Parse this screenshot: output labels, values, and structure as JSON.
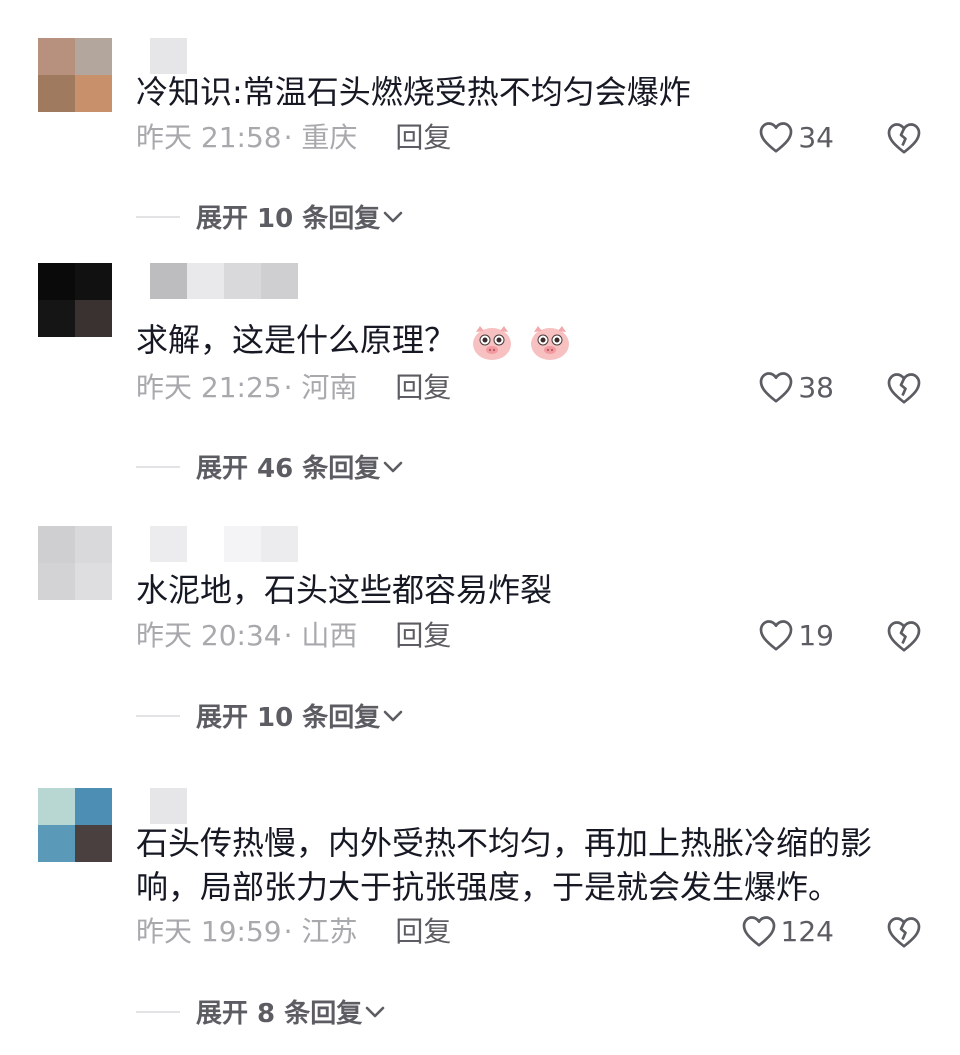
{
  "comments": [
    {
      "avatar_colors": [
        "#b8907e",
        "#b3a69c",
        "#a07a5e",
        "#c8916c"
      ],
      "name_colors": [
        "#e6e6e8"
      ],
      "text": "冷知识:常温石头燃烧受热不均匀会爆炸",
      "time": "昨天 21:58",
      "location": "· 重庆",
      "reply_label": "回复",
      "likes": "34",
      "expand_label": "展开 10 条回复"
    },
    {
      "avatar_colors": [
        "#0a0a0a",
        "#111111",
        "#151515",
        "#3a3230"
      ],
      "name_colors": [
        "#bdbdbf",
        "#e9e9eb",
        "#d9d9db",
        "#cfcfd1"
      ],
      "text": "求解，这是什么原理？",
      "emojis": [
        "pig-face-emoji",
        "pig-face-emoji"
      ],
      "time": "昨天 21:25",
      "location": "· 河南",
      "reply_label": "回复",
      "likes": "38",
      "expand_label": "展开 46 条回复"
    },
    {
      "avatar_colors": [
        "#cfcfd1",
        "#d9d9db",
        "#d3d3d5",
        "#dedee0"
      ],
      "name_colors": [
        "#ececee",
        "#ffffff",
        "#f4f4f6",
        "#ececee"
      ],
      "text": "水泥地，石头这些都容易炸裂",
      "time": "昨天 20:34",
      "location": "· 山西",
      "reply_label": "回复",
      "likes": "19",
      "expand_label": "展开 10 条回复"
    },
    {
      "avatar_colors": [
        "#b8d6d2",
        "#4d8eb5",
        "#5a9ab8",
        "#4a4040"
      ],
      "name_colors": [
        "#e6e6e8"
      ],
      "text": "石头传热慢，内外受热不均匀，再加上热胀冷缩的影响，局部张力大于抗张强度，于是就会发生爆炸。",
      "time": "昨天 19:59",
      "location": "· 江苏",
      "reply_label": "回复",
      "likes": "124",
      "expand_label": "展开 8 条回复"
    }
  ],
  "icons": {
    "like": "heart-outline-icon",
    "dislike": "broken-heart-icon",
    "expand": "chevron-down-icon"
  },
  "colors": {
    "text_primary": "#161823",
    "text_secondary": "#a8a9ad",
    "action": "#5c5d63"
  }
}
